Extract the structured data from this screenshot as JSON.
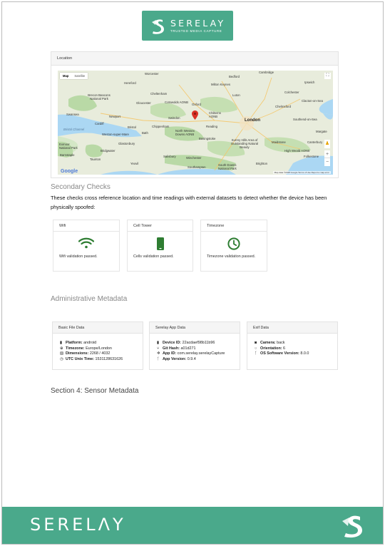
{
  "header": {
    "brand": "SERELAY",
    "tagline": "TRUSTED MEDIA CAPTURE"
  },
  "location": {
    "title": "Location",
    "map_type": {
      "map": "Map",
      "satellite": "Satellite"
    },
    "google": "Google",
    "footer": "Map data ©2018 Google   Terms of Use   Report a map error",
    "labels": {
      "worcester": "Worcester",
      "hereford": "Hereford",
      "cheltenham": "Cheltenham",
      "gloucester": "Gloucester",
      "brecon": "Brecon Beacons National Park",
      "cotswolds": "Cotswolds AONB",
      "oxford": "Oxford",
      "bedford": "Bedford",
      "cambridge": "Cambridge",
      "ipswich": "Ipswich",
      "milton": "Milton Keynes",
      "luton": "Luton",
      "chilterns": "Chilterns AONB",
      "colchester": "Colchester",
      "chelmsford": "Chelmsford",
      "clacton": "Clacton-on-Sea",
      "swansea": "Swansea",
      "newport": "Newport",
      "cardiff": "Cardiff",
      "bristol": "Bristol",
      "bath": "Bath",
      "chippenham": "Chippenham",
      "swindon": "Swindon",
      "wessex": "North Wessex Downs AONB",
      "reading": "Reading",
      "london": "London",
      "southend": "Southend-on-Sea",
      "margate": "Margate",
      "weston": "Weston-super-Mare",
      "basingstoke": "Basingstoke",
      "surrey": "Surrey Hills Area of Outstanding Natural Beauty",
      "maidstone": "Maidstone",
      "canterbury": "Canterbury",
      "exmoor": "Exmoor National Park",
      "barnstaple": "Barnstaple",
      "taunton": "Taunton",
      "salisbury": "Salisbury",
      "winchester": "Winchester",
      "brighton": "Brighton",
      "southdowns": "South Downs National Park",
      "southampton": "Southampton",
      "yeovil": "Yeovil",
      "highweald": "High Weald AONB",
      "folkestone": "Folkestone",
      "bridgwater": "Bridgwater",
      "glastonbury": "Glastonbury",
      "swsea": "Bristol Channel"
    }
  },
  "secondary": {
    "title": "Secondary Checks",
    "description": "These checks cross reference location and time readings with external datasets to detect whether the device has been physically spoofed:",
    "checks": [
      {
        "title": "Wifi",
        "message": "Wifi validation passed.",
        "icon": "wifi-icon"
      },
      {
        "title": "Cell Tower",
        "message": "Cells validation passed.",
        "icon": "phone-icon"
      },
      {
        "title": "Timezone",
        "message": "Timezone validation passed.",
        "icon": "clock-icon"
      }
    ],
    "check_color": "#2e7d32"
  },
  "admin": {
    "title": "Administrative Metadata",
    "basic": {
      "title": "Basic File Data",
      "platform_k": "Platform:",
      "platform_v": "android",
      "timezone_k": "Timezone:",
      "timezone_v": "Europe/London",
      "dimensions_k": "Dimensions:",
      "dimensions_v": "2268 / 4032",
      "unix_k": "UTC Unix Time:",
      "unix_v": "1531128631626"
    },
    "app": {
      "title": "Serelay App Data",
      "device_k": "Device ID:",
      "device_v": "22acdaef98b11b96",
      "git_k": "Git Hash:",
      "git_v": "a01d271",
      "appid_k": "App ID:",
      "appid_v": "com.serelay.serelayCapture",
      "version_k": "App Version:",
      "version_v": "0.9.4"
    },
    "exif": {
      "title": "Exif Data",
      "camera_k": "Camera:",
      "camera_v": "back",
      "orientation_k": "Orientation:",
      "orientation_v": "6",
      "os_k": "OS Software Version:",
      "os_v": "8.0.0"
    }
  },
  "section4": {
    "title": "Section 4: Sensor Metadata"
  },
  "footer": {
    "brand": "SERELΛY"
  },
  "colors": {
    "brand": "#4aa98b",
    "pin": "#d93025"
  }
}
